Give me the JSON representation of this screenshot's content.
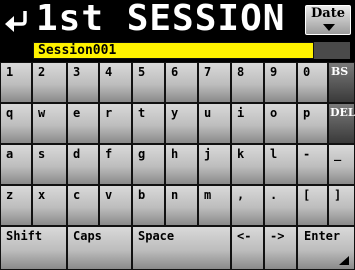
{
  "header": {
    "title": "1st SESSION",
    "date_button_label": "Date"
  },
  "name_field": {
    "value": "Session001"
  },
  "keyboard": {
    "row1": [
      "1",
      "2",
      "3",
      "4",
      "5",
      "6",
      "7",
      "8",
      "9",
      "0",
      "BS"
    ],
    "row2": [
      "q",
      "w",
      "e",
      "r",
      "t",
      "y",
      "u",
      "i",
      "o",
      "p",
      "DEL"
    ],
    "row3": [
      "a",
      "s",
      "d",
      "f",
      "g",
      "h",
      "j",
      "k",
      "l",
      "-",
      "_"
    ],
    "row4": [
      "z",
      "x",
      "c",
      "v",
      "b",
      "n",
      "m",
      ",",
      ".",
      "[",
      "]"
    ],
    "row5": [
      "Shift",
      "Caps",
      "Space",
      "<-",
      "->",
      "Enter"
    ]
  },
  "icons": {
    "back": "return-arrow-icon",
    "date_dropdown": "chevron-down-icon",
    "enter": "enter-corner-icon"
  }
}
